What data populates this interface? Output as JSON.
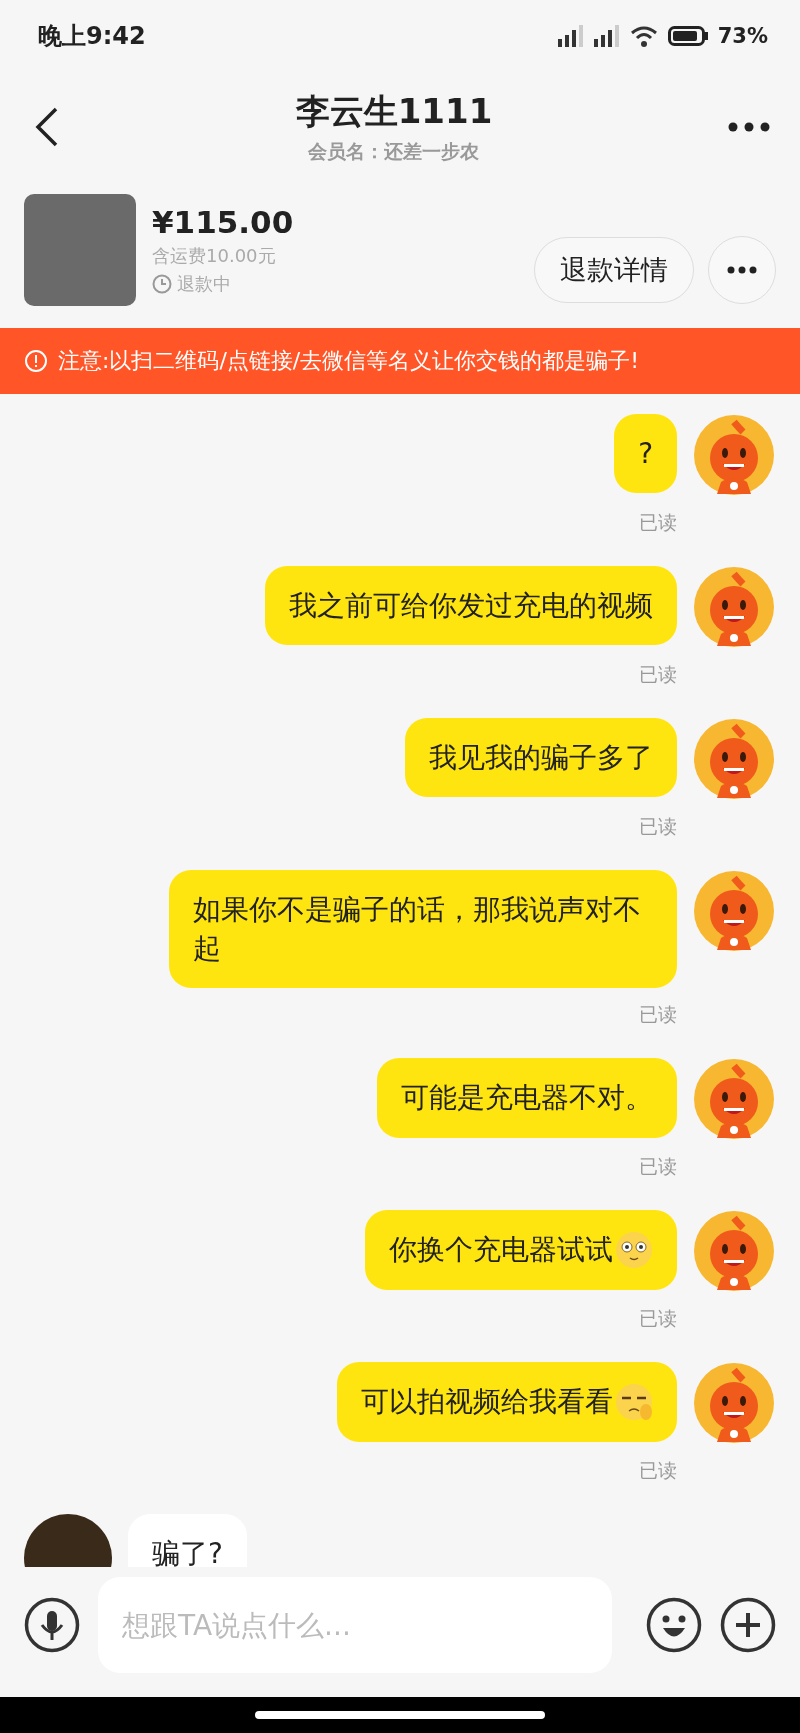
{
  "status_bar": {
    "time": "晚上9:42",
    "battery": "73%"
  },
  "header": {
    "title": "李云生1111",
    "subtitle": "会员名：还差一步农"
  },
  "order": {
    "price": "¥115.00",
    "shipping": "含运费10.00元",
    "status": "退款中",
    "button": "退款详情"
  },
  "warning": "注意:以扫二维码/点链接/去微信等名义让你交钱的都是骗子!",
  "messages": [
    {
      "kind": "outgoing",
      "text": "?",
      "status": "已读"
    },
    {
      "kind": "outgoing",
      "text": "我之前可给你发过充电的视频",
      "status": "已读"
    },
    {
      "kind": "outgoing",
      "text": "我见我的骗子多了",
      "status": "已读"
    },
    {
      "kind": "outgoing",
      "text": "如果你不是骗子的话，那我说声对不起",
      "status": "已读"
    },
    {
      "kind": "outgoing",
      "text": "可能是充电器不对。",
      "status": "已读"
    },
    {
      "kind": "outgoing",
      "text": "你换个充电器试试",
      "emoji": {
        "kind": "wide-eyes"
      },
      "status": "已读"
    },
    {
      "kind": "outgoing",
      "text": "可以拍视频给我看看",
      "emoji": {
        "kind": "unamused"
      },
      "status": "已读"
    },
    {
      "kind": "incoming",
      "text": "骗了?"
    }
  ],
  "input": {
    "placeholder": "想跟TA说点什么..."
  }
}
